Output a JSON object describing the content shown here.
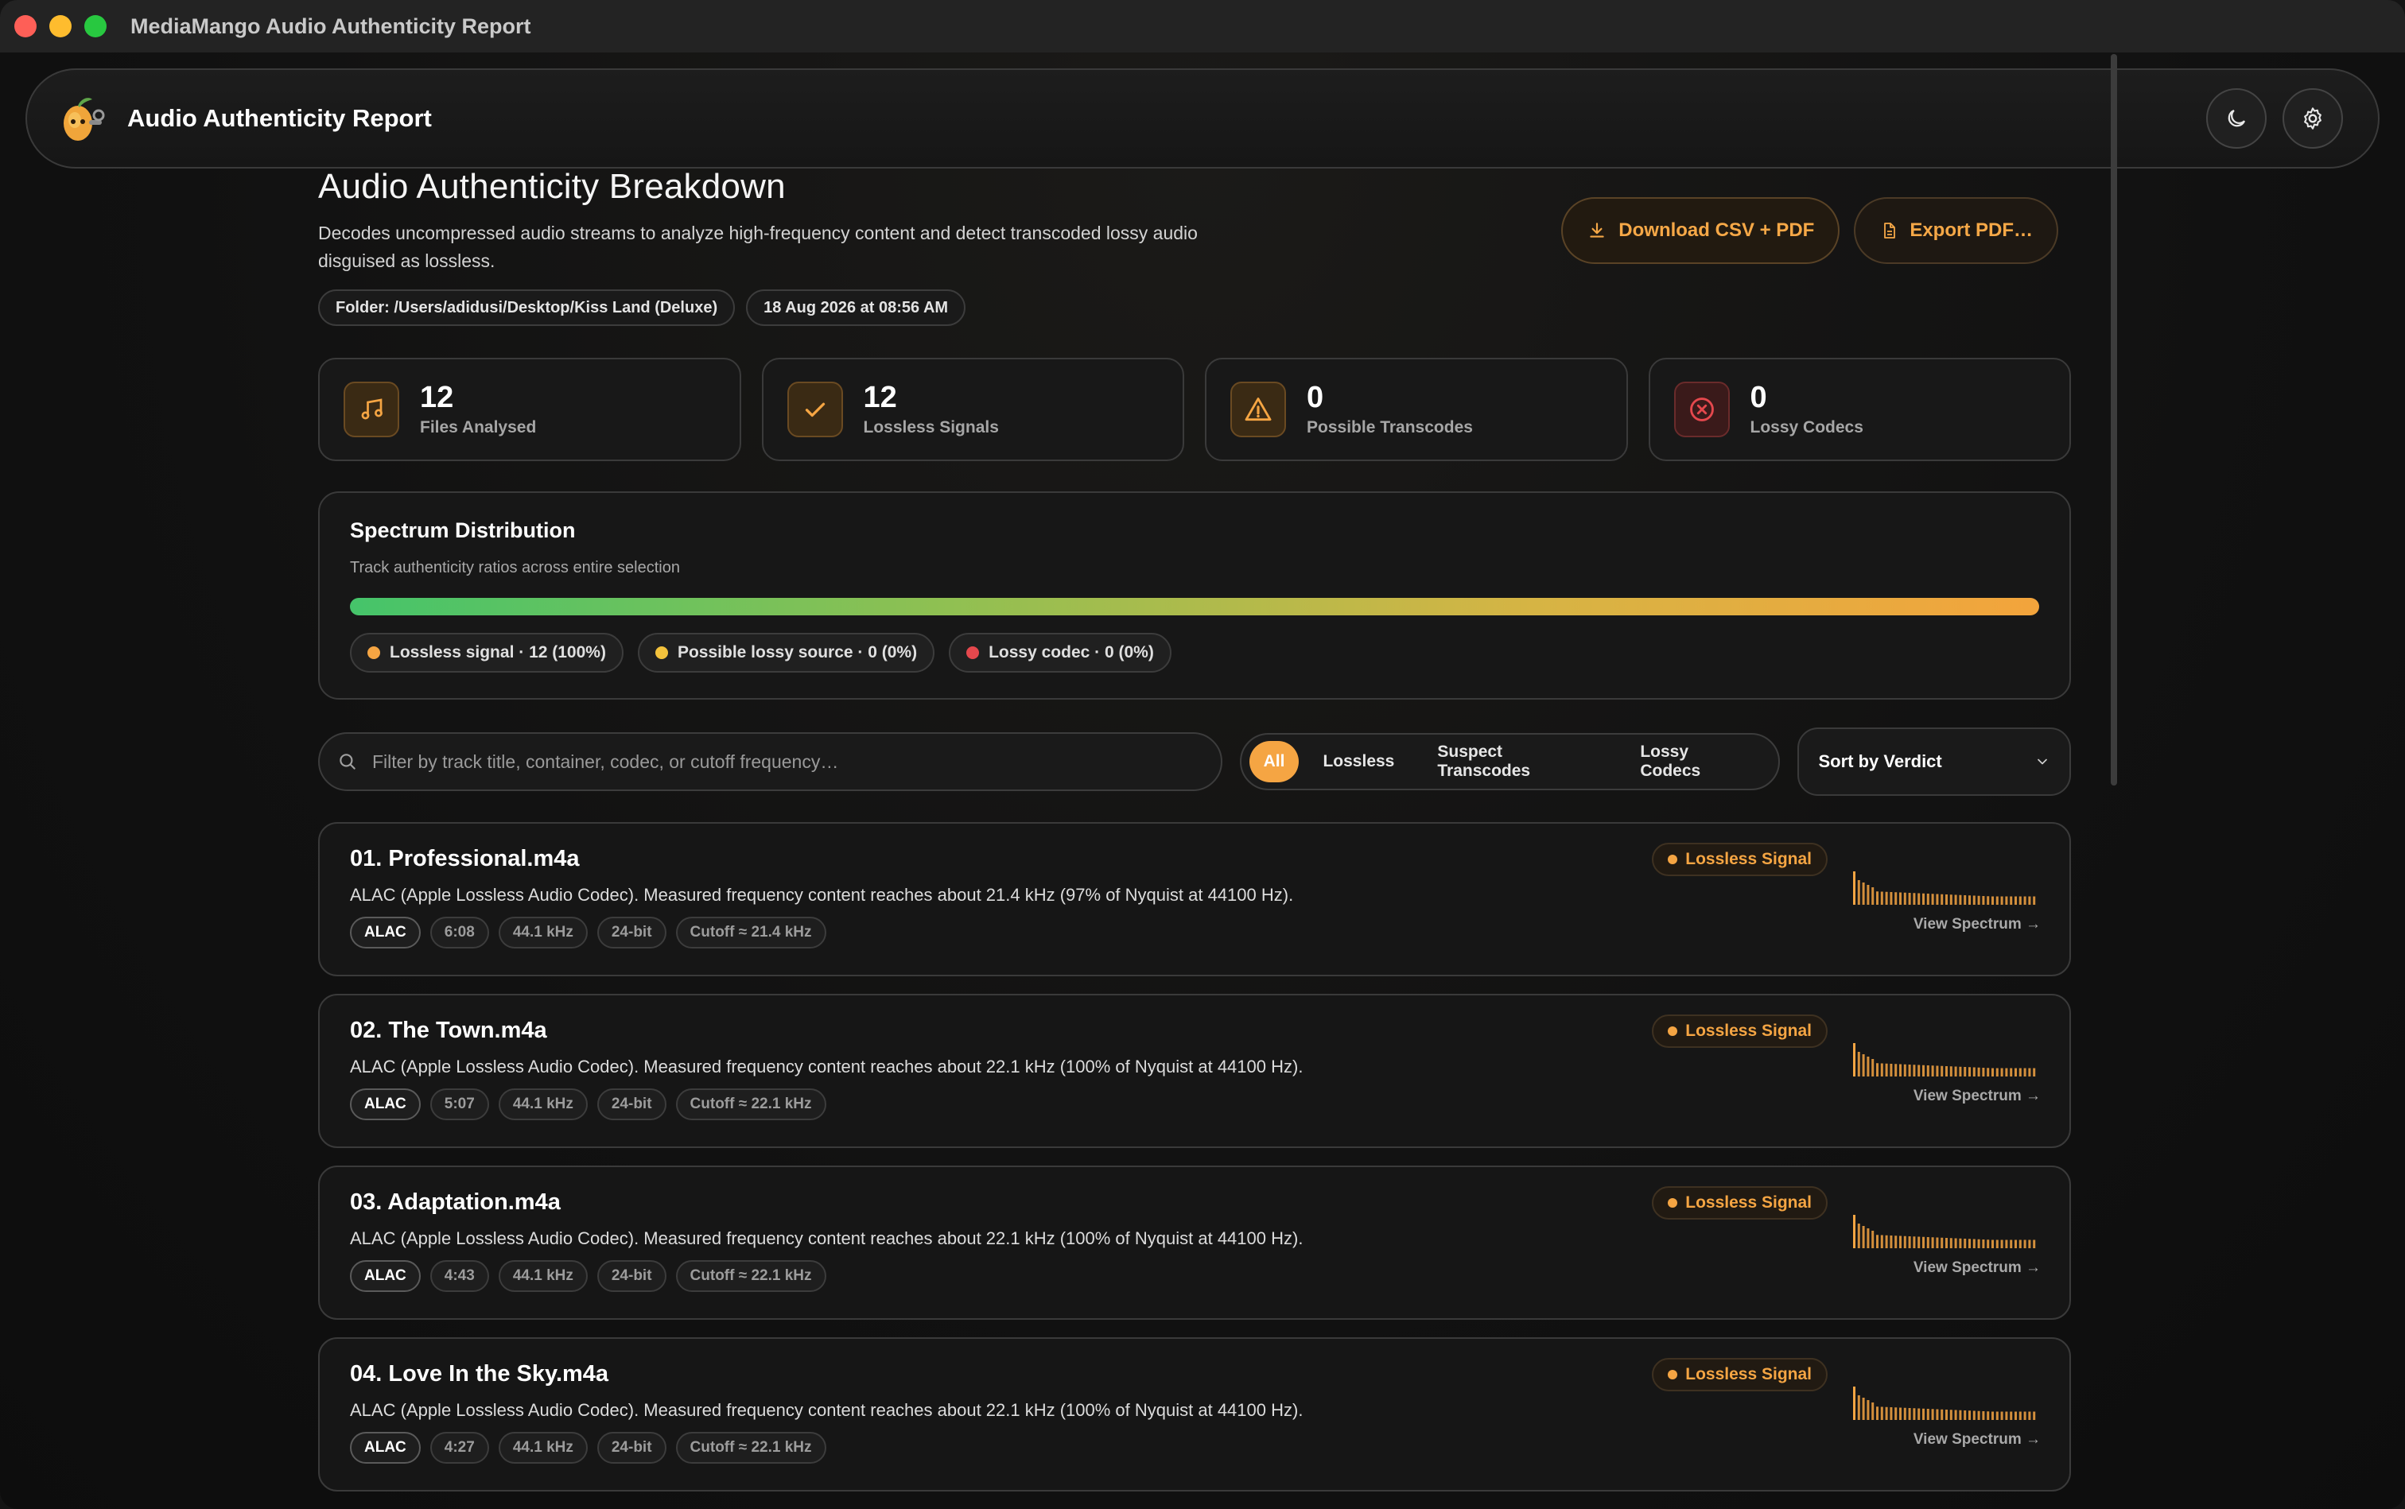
{
  "window": {
    "title": "MediaMango Audio Authenticity Report"
  },
  "appbar": {
    "title": "Audio Authenticity Report"
  },
  "header": {
    "title": "Audio Authenticity Breakdown",
    "description": "Decodes uncompressed audio streams to analyze high-frequency content and detect transcoded lossy audio disguised as lossless.",
    "folder": "Folder: /Users/adidusi/Desktop/Kiss Land (Deluxe)",
    "date": "18 Aug 2026 at 08:56 AM",
    "download_label": "Download CSV + PDF",
    "export_label": "Export PDF…"
  },
  "stats": [
    {
      "value": "12",
      "label": "Files Analysed",
      "icon": "music-note-icon"
    },
    {
      "value": "12",
      "label": "Lossless Signals",
      "icon": "checkmark-icon"
    },
    {
      "value": "0",
      "label": "Possible Transcodes",
      "icon": "warning-icon"
    },
    {
      "value": "0",
      "label": "Lossy Codecs",
      "icon": "error-icon"
    }
  ],
  "spectrum": {
    "title": "Spectrum Distribution",
    "subtitle": "Track authenticity ratios across entire selection",
    "legend": [
      {
        "label": "Lossless signal · 12 (100%)",
        "color": "#f5a543"
      },
      {
        "label": "Possible lossy source · 0 (0%)",
        "color": "#f3c23c"
      },
      {
        "label": "Lossy codec · 0 (0%)",
        "color": "#e5484d"
      }
    ]
  },
  "filters": {
    "search_placeholder": "Filter by track title, container, codec, or cutoff frequency…",
    "segments": [
      "All",
      "Lossless",
      "Suspect Transcodes",
      "Lossy Codecs"
    ],
    "active_segment": "All",
    "sort_label": "Sort by Verdict"
  },
  "tracks": [
    {
      "title": "01. Professional.m4a",
      "description": "ALAC (Apple Lossless Audio Codec). Measured frequency content reaches about 21.4 kHz (97% of Nyquist at 44100 Hz).",
      "chips": [
        "ALAC",
        "6:08",
        "44.1 kHz",
        "24-bit",
        "Cutoff ≈ 21.4 kHz"
      ],
      "verdict": "Lossless Signal",
      "view_label": "View Spectrum →"
    },
    {
      "title": "02. The Town.m4a",
      "description": "ALAC (Apple Lossless Audio Codec). Measured frequency content reaches about 22.1 kHz (100% of Nyquist at 44100 Hz).",
      "chips": [
        "ALAC",
        "5:07",
        "44.1 kHz",
        "24-bit",
        "Cutoff ≈ 22.1 kHz"
      ],
      "verdict": "Lossless Signal",
      "view_label": "View Spectrum →"
    },
    {
      "title": "03. Adaptation.m4a",
      "description": "ALAC (Apple Lossless Audio Codec). Measured frequency content reaches about 22.1 kHz (100% of Nyquist at 44100 Hz).",
      "chips": [
        "ALAC",
        "4:43",
        "44.1 kHz",
        "24-bit",
        "Cutoff ≈ 22.1 kHz"
      ],
      "verdict": "Lossless Signal",
      "view_label": "View Spectrum →"
    },
    {
      "title": "04. Love In the Sky.m4a",
      "description": "ALAC (Apple Lossless Audio Codec). Measured frequency content reaches about 22.1 kHz (100% of Nyquist at 44100 Hz).",
      "chips": [
        "ALAC",
        "4:27",
        "44.1 kHz",
        "24-bit",
        "Cutoff ≈ 22.1 kHz"
      ],
      "verdict": "Lossless Signal",
      "view_label": "View Spectrum →"
    }
  ],
  "colors": {
    "accent": "#f5a543",
    "background": "#111111",
    "card_border": "#3a3a3a"
  }
}
